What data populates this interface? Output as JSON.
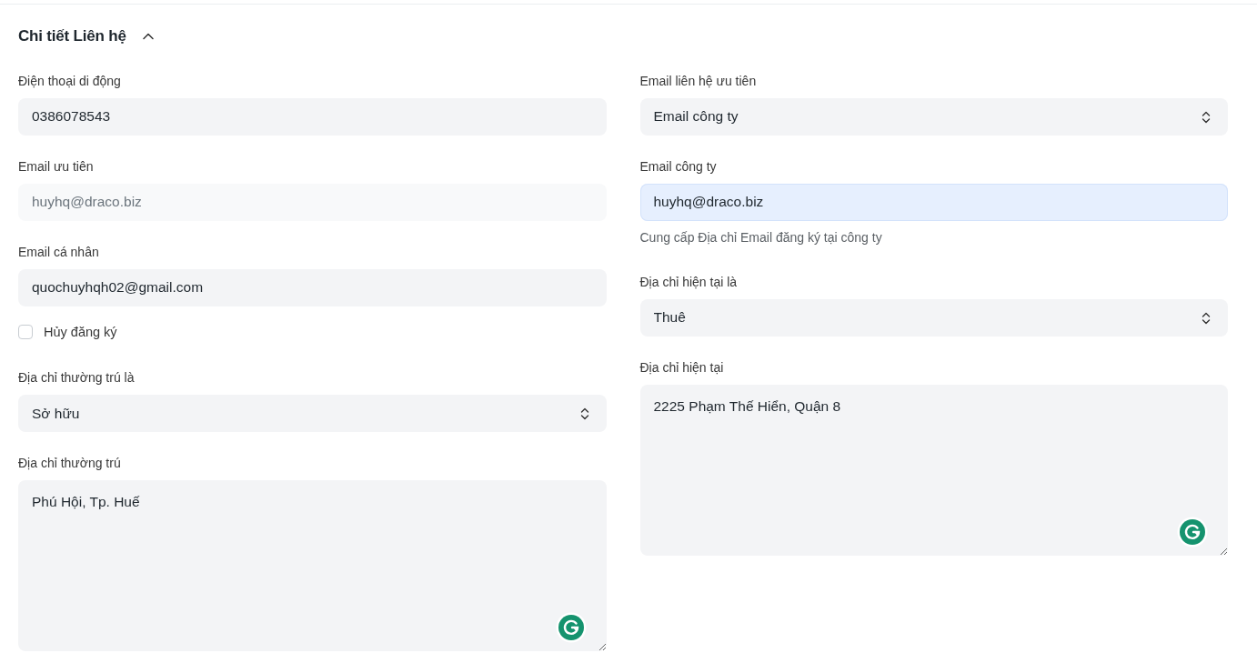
{
  "section": {
    "title": "Chi tiết Liên hệ",
    "expanded": true
  },
  "columns": [
    {
      "fields": [
        {
          "kind": "input",
          "label": "Điện thoại di động",
          "value": "0386078543",
          "disabled": false,
          "focused": false
        },
        {
          "kind": "input",
          "label": "Email ưu tiên",
          "value": "huyhq@draco.biz",
          "disabled": true,
          "focused": false
        },
        {
          "kind": "input",
          "label": "Email cá nhân",
          "value": "quochuyhqh02@gmail.com",
          "disabled": false,
          "focused": false
        },
        {
          "kind": "checkbox",
          "label": "Hủy đăng ký",
          "checked": false
        },
        {
          "kind": "select",
          "label": "Địa chỉ thường trú là",
          "value": "Sở hữu"
        },
        {
          "kind": "textarea",
          "label": "Địa chỉ thường trú",
          "value": "Phú Hội, Tp. Huế"
        }
      ]
    },
    {
      "fields": [
        {
          "kind": "select",
          "label": "Email liên hệ ưu tiên",
          "value": "Email công ty"
        },
        {
          "kind": "input",
          "label": "Email công ty",
          "value": "huyhq@draco.biz",
          "disabled": false,
          "focused": true,
          "help": "Cung cấp Địa chỉ Email đăng ký tại công ty"
        },
        {
          "kind": "select",
          "label": "Địa chỉ hiện tại là",
          "value": "Thuê"
        },
        {
          "kind": "textarea",
          "label": "Địa chỉ hiện tại",
          "value": "2225 Phạm Thế Hiển, Quận 8"
        }
      ]
    }
  ]
}
